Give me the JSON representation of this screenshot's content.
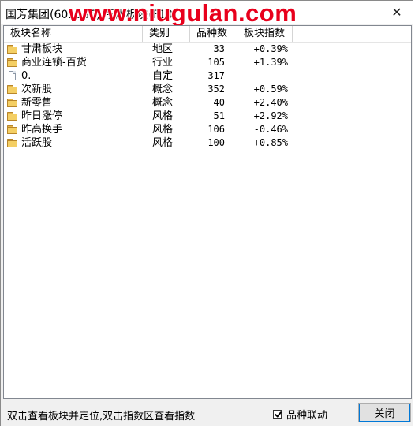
{
  "window": {
    "title": "国芳集团(601086) 所属板块(F10)",
    "watermark": "www.niugulan.com",
    "close_glyph": "✕"
  },
  "table": {
    "columns": [
      "板块名称",
      "类别",
      "品种数",
      "板块指数"
    ],
    "rows": [
      {
        "icon": "folder-icon",
        "name": "甘肃板块",
        "type": "地区",
        "count": "33",
        "index": "+0.39%"
      },
      {
        "icon": "folder-icon",
        "name": "商业连锁-百货",
        "type": "行业",
        "count": "105",
        "index": "+1.39%"
      },
      {
        "icon": "file-icon",
        "name": "0.",
        "type": "自定",
        "count": "317",
        "index": ""
      },
      {
        "icon": "folder-icon",
        "name": "次新股",
        "type": "概念",
        "count": "352",
        "index": "+0.59%"
      },
      {
        "icon": "folder-icon",
        "name": "新零售",
        "type": "概念",
        "count": "40",
        "index": "+2.40%"
      },
      {
        "icon": "folder-icon",
        "name": "昨日涨停",
        "type": "风格",
        "count": "51",
        "index": "+2.92%"
      },
      {
        "icon": "folder-icon",
        "name": "昨高换手",
        "type": "风格",
        "count": "106",
        "index": "-0.46%"
      },
      {
        "icon": "folder-icon",
        "name": "活跃股",
        "type": "风格",
        "count": "100",
        "index": "+0.85%"
      }
    ]
  },
  "footer": {
    "status": "双击查看板块并定位,双击指数区查看指数",
    "checkbox_label": "品种联动",
    "checkbox_checked": true,
    "close_button": "关闭"
  },
  "colors": {
    "watermark": "#e8001c",
    "folder": "#f4cf64",
    "focus_outline": "#0078d7"
  }
}
